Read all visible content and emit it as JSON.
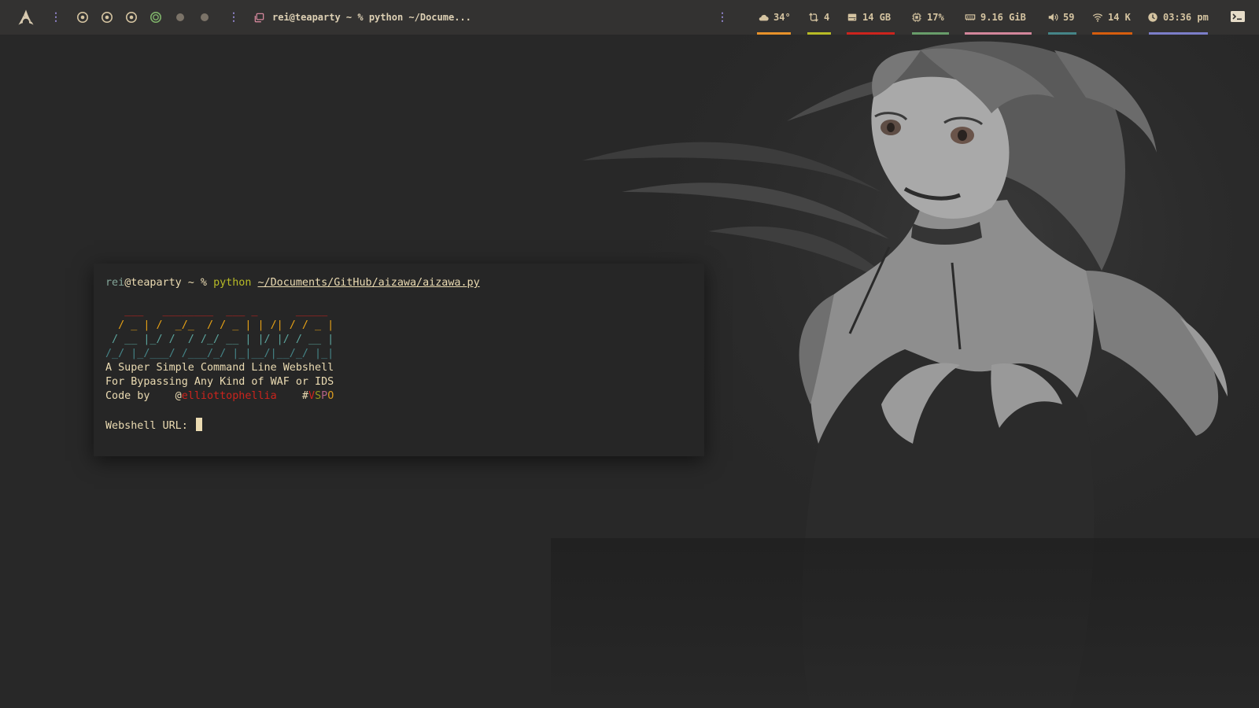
{
  "topbar": {
    "logo_icon": "arch-linux-icon",
    "workspaces": [
      {
        "state": "occupied"
      },
      {
        "state": "occupied"
      },
      {
        "state": "occupied"
      },
      {
        "state": "active"
      },
      {
        "state": "empty"
      },
      {
        "state": "empty"
      }
    ],
    "window_title": "rei@teaparty ~ % python ~/Docume...",
    "modules": {
      "weather": {
        "icon": "cloud-icon",
        "value": "34°",
        "color": "#e8922a"
      },
      "updates": {
        "icon": "sync-icon",
        "value": "4",
        "color": "#b8bb26"
      },
      "disk": {
        "icon": "disk-icon",
        "value": "14 GB",
        "color": "#cc241d"
      },
      "cpu": {
        "icon": "cpu-icon",
        "value": "17%",
        "color": "#689d6a"
      },
      "memory": {
        "icon": "memory-icon",
        "value": "9.16 GiB",
        "color": "#d3869b"
      },
      "volume": {
        "icon": "volume-icon",
        "value": "59",
        "color": "#458588"
      },
      "network": {
        "icon": "wifi-icon",
        "value": "14 K",
        "color": "#d65d0e"
      },
      "clock": {
        "icon": "clock-icon",
        "value": "03:36 pm",
        "color": "#7c7ec9"
      }
    },
    "terminal_toggle_icon": "terminal-icon"
  },
  "terminal": {
    "prompt": {
      "user": "rei",
      "host": "@teaparty ~ % ",
      "command": "python",
      "path": "~/Documents/GitHub/aizawa/aizawa.py"
    },
    "banner": [
      "   ___   ________  ___ _      _____ ",
      "  / _ | /  _/_  / / _ | | /| / / _ |",
      " / __ |_/ /  / /_/ __ | |/ |/ / __ |",
      "/_/ |_/___/ /___/_/ |_|__/|__/_/ |_|"
    ],
    "tagline_1": "A Super Simple Command Line Webshell",
    "tagline_2": "For Bypassing Any Kind of WAF or IDS",
    "credit_prefix": "Code by    @",
    "credit_author": "elliottophellia",
    "credit_hash": "    #",
    "credit_tag": [
      "V",
      "S",
      "P",
      "O"
    ],
    "input_label": "Webshell URL: "
  }
}
